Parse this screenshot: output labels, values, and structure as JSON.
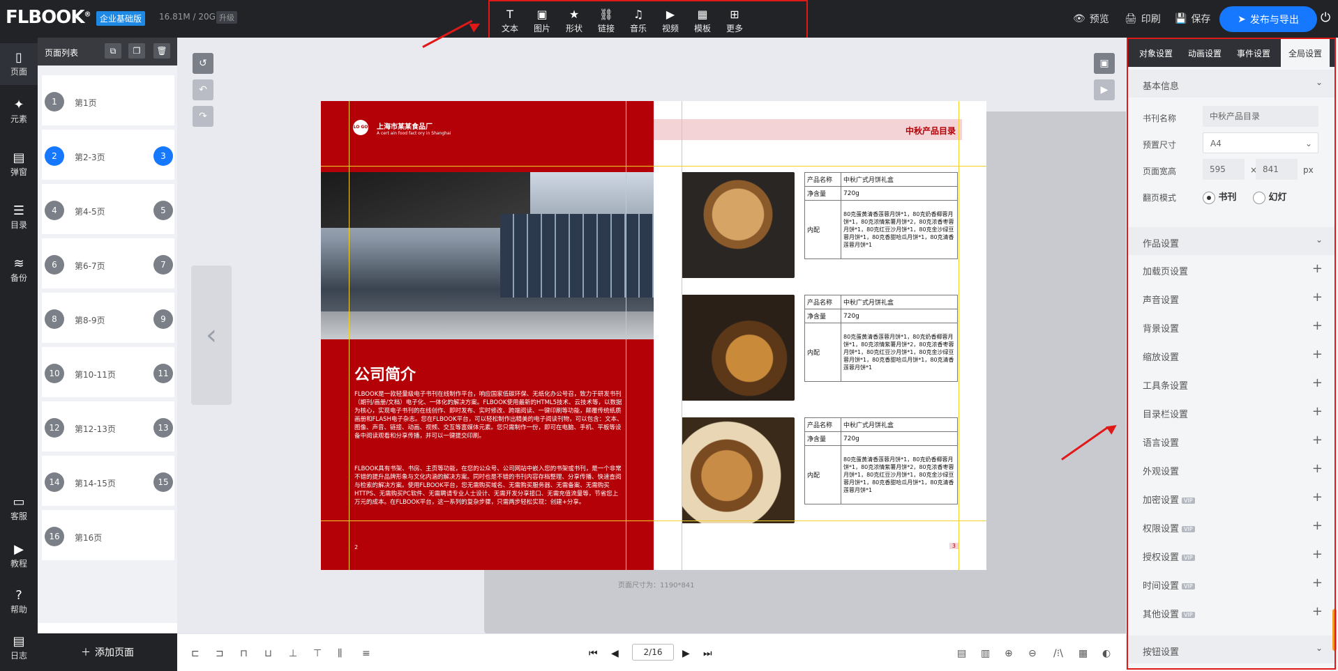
{
  "app": {
    "logo": "FLBOOK",
    "edition": "企业基础版",
    "storage": "16.81M / 20G",
    "upgrade": "升级"
  },
  "toolbar": {
    "items": [
      {
        "label": "文本",
        "icon": "text-icon",
        "glyph": "T"
      },
      {
        "label": "图片",
        "icon": "image-icon",
        "glyph": "▣"
      },
      {
        "label": "形状",
        "icon": "star-icon",
        "glyph": "★"
      },
      {
        "label": "链接",
        "icon": "link-icon",
        "glyph": "⛓"
      },
      {
        "label": "音乐",
        "icon": "music-icon",
        "glyph": "♫"
      },
      {
        "label": "视频",
        "icon": "video-icon",
        "glyph": "▶"
      },
      {
        "label": "模板",
        "icon": "template-icon",
        "glyph": "▦"
      },
      {
        "label": "更多",
        "icon": "more-icon",
        "glyph": "⊞"
      }
    ]
  },
  "header_actions": {
    "preview": "预览",
    "print": "印刷",
    "save": "保存",
    "publish": "发布与导出"
  },
  "leftnav": {
    "items": [
      {
        "label": "页面",
        "icon": "page-icon"
      },
      {
        "label": "元素",
        "icon": "elements-icon"
      },
      {
        "label": "弹窗",
        "icon": "popup-icon"
      },
      {
        "label": "目录",
        "icon": "toc-icon"
      },
      {
        "label": "备份",
        "icon": "backup-icon"
      },
      {
        "label": "客服",
        "icon": "service-icon"
      },
      {
        "label": "教程",
        "icon": "tutorial-icon"
      },
      {
        "label": "帮助",
        "icon": "help-icon"
      },
      {
        "label": "日志",
        "icon": "log-icon"
      }
    ]
  },
  "pagepanel": {
    "title": "页面列表",
    "add_page": "添加页面",
    "pages": [
      {
        "n1": "1",
        "label": "第1页",
        "n2": ""
      },
      {
        "n1": "2",
        "label": "第2-3页",
        "n2": "3"
      },
      {
        "n1": "4",
        "label": "第4-5页",
        "n2": "5"
      },
      {
        "n1": "6",
        "label": "第6-7页",
        "n2": "7"
      },
      {
        "n1": "8",
        "label": "第8-9页",
        "n2": "9"
      },
      {
        "n1": "10",
        "label": "第10-11页",
        "n2": "11"
      },
      {
        "n1": "12",
        "label": "第12-13页",
        "n2": "13"
      },
      {
        "n1": "14",
        "label": "第14-15页",
        "n2": "15"
      },
      {
        "n1": "16",
        "label": "第16页",
        "n2": ""
      }
    ]
  },
  "book": {
    "company_name": "上海市某某食品厂",
    "company_sub": "A cert ain food fact ory in Shanghai",
    "logo_text": "LO GO",
    "intro_title": "公司简介",
    "intro_p1": "FLBOOK是一款轻量级电子书刊在线制作平台，响应国家低碳环保、无纸化办公号召，致力于研发书刊（期刊/画册/文档）电子化、一体化的解决方案。FLBOOK使用最新的HTML5技术、云技术等，以数据为核心，实现电子书刊的在线创作、即时发布、实时修改、跨端阅读、一键印刷等功能，颠覆传统纸质画册和FLASH电子杂志。您在FLBOOK平台，可以轻松制作出精美的电子阅读刊物，可以包含：文本、图像、声音、链接、动画、视频、交互等富媒体元素。您只需制作一份，即可在电脑、手机、平板等设备中阅读观看和分享传播，并可以一键提交印刷。",
    "intro_p2": "FLBOOK具有书架、书房、主页等功能，在您的公众号、公司网站中嵌入您的书架或书刊，是一个非常不错的提升品牌形象与文化内涵的解决方案。同时也是不错的书刊内容存档整理、分享传播、快速查阅与检索的解决方案。使用FLBOOK平台，您无需购买域名、无需购买服务器、无需备案、无需购买HTTPS、无需购买PC软件、无需聘请专业人士设计、无需开发分享接口、无需充值流量等，节省您上万元的成本。在FLBOOK平台，这一系列的复杂步骤，只需两步轻松实现：创建+分享。",
    "page_left_num": "2",
    "page_right_num": "3",
    "right_title": "中秋产品目录",
    "size_label": "页面尺寸为：1190*841",
    "products": [
      {
        "name_label": "产品名称",
        "name": "中秋广式月饼礼盒",
        "weight_label": "净含量",
        "weight": "720g",
        "content_label": "内配",
        "content": "80克蛋黄清香莲蓉月饼*1，80克奶香椰蓉月饼*1，80克浓情紫薯月饼*2，80克浓香枣蓉月饼*1，80克红豆沙月饼*1，80克金沙绿豆蓉月饼*1，80克香甜哈瓜月饼*1，80克清香莲蓉月饼*1"
      },
      {
        "name_label": "产品名称",
        "name": "中秋广式月饼礼盒",
        "weight_label": "净含量",
        "weight": "720g",
        "content_label": "内配",
        "content": "80克蛋黄清香莲蓉月饼*1，80克奶香椰蓉月饼*1，80克浓情紫薯月饼*2，80克浓香枣蓉月饼*1，80克红豆沙月饼*1，80克金沙绿豆蓉月饼*1，80克香甜哈瓜月饼*1，80克清香莲蓉月饼*1"
      },
      {
        "name_label": "产品名称",
        "name": "中秋广式月饼礼盒",
        "weight_label": "净含量",
        "weight": "720g",
        "content_label": "内配",
        "content": "80克蛋黄清香莲蓉月饼*1，80克奶香椰蓉月饼*1，80克浓情紫薯月饼*2，80克浓香枣蓉月饼*1，80克红豆沙月饼*1，80克金沙绿豆蓉月饼*1，80克香甜哈瓜月饼*1，80克清香莲蓉月饼*1"
      }
    ]
  },
  "bottombar": {
    "page_value": "2/16"
  },
  "rightpanel": {
    "tabs": [
      "对象设置",
      "动画设置",
      "事件设置",
      "全局设置"
    ],
    "basic_info": "基本信息",
    "book_name_label": "书刊名称",
    "book_name_value": "中秋产品目录",
    "preset_size_label": "预置尺寸",
    "preset_size_value": "A4",
    "page_size_label": "页面宽高",
    "width_value": "595",
    "height_value": "841",
    "times": "×",
    "unit": "px",
    "flip_mode_label": "翻页模式",
    "flip_book": "书刊",
    "flip_slide": "幻灯",
    "work_settings": "作品设置",
    "settings": [
      {
        "label": "加载页设置",
        "vip": ""
      },
      {
        "label": "声音设置",
        "vip": ""
      },
      {
        "label": "背景设置",
        "vip": ""
      },
      {
        "label": "缩放设置",
        "vip": ""
      },
      {
        "label": "工具条设置",
        "vip": ""
      },
      {
        "label": "目录栏设置",
        "vip": ""
      },
      {
        "label": "语言设置",
        "vip": ""
      },
      {
        "label": "外观设置",
        "vip": ""
      },
      {
        "label": "加密设置",
        "vip": "VIP"
      },
      {
        "label": "权限设置",
        "vip": "VIP"
      },
      {
        "label": "授权设置",
        "vip": "VIP"
      },
      {
        "label": "时间设置",
        "vip": "VIP"
      },
      {
        "label": "其他设置",
        "vip": "VIP"
      }
    ],
    "button_settings": "按钮设置"
  },
  "colors": {
    "accent": "#1677ff",
    "annotation": "#e01818",
    "book_red": "#b40007"
  }
}
